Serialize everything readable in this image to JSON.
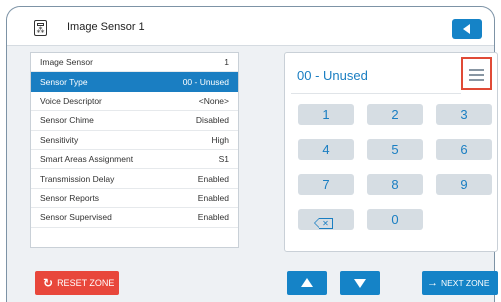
{
  "header": {
    "title": "Image Sensor 1",
    "device_icon": "panel-device-icon",
    "back_icon": "back-arrow-icon"
  },
  "settings": [
    {
      "label": "Image Sensor",
      "value": "1",
      "selected": false
    },
    {
      "label": "Sensor Type",
      "value": "00 - Unused",
      "selected": true
    },
    {
      "label": "Voice Descriptor",
      "value": "<None>",
      "selected": false
    },
    {
      "label": "Sensor Chime",
      "value": "Disabled",
      "selected": false
    },
    {
      "label": "Sensitivity",
      "value": "High",
      "selected": false
    },
    {
      "label": "Smart Areas Assignment",
      "value": "S1",
      "selected": false
    },
    {
      "label": "Transmission Delay",
      "value": "Enabled",
      "selected": false
    },
    {
      "label": "Sensor Reports",
      "value": "Enabled",
      "selected": false
    },
    {
      "label": "Sensor Supervised",
      "value": "Enabled",
      "selected": false
    }
  ],
  "keypad": {
    "display": "00 - Unused",
    "menu_icon": "hamburger-menu-icon",
    "keys": [
      "1",
      "2",
      "3",
      "4",
      "5",
      "6",
      "7",
      "8",
      "9"
    ],
    "zero": "0",
    "backspace_glyph": "✕",
    "backspace_icon": "backspace-icon"
  },
  "footer": {
    "reset_label": "RESET ZONE",
    "reset_glyph": "↻",
    "up_icon": "arrow-up-icon",
    "down_icon": "arrow-down-icon",
    "next_label": "NEXT ZONE",
    "next_glyph": "→"
  },
  "colors": {
    "accent": "#1583c7",
    "selected_row": "#1a7ec2",
    "reset": "#e8473b",
    "highlight_border": "#e04a36",
    "key_bg": "#d6dde3"
  }
}
